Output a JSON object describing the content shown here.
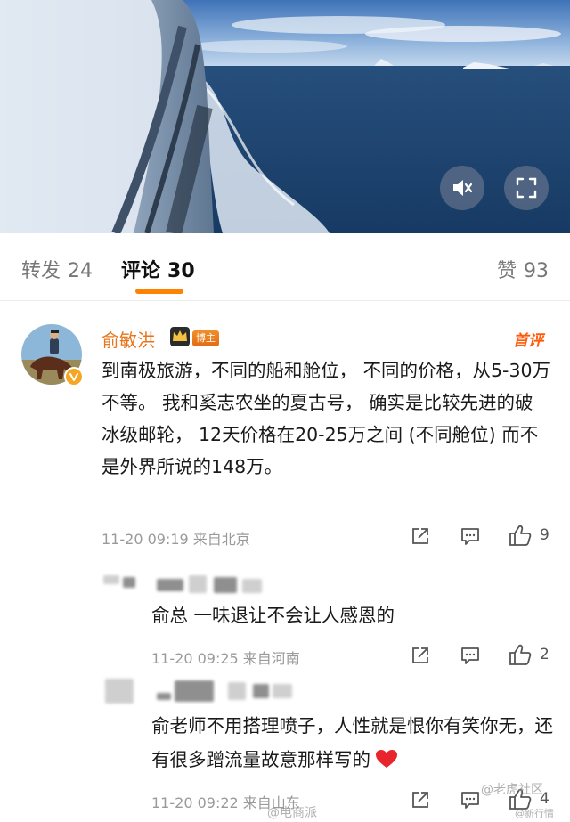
{
  "video": {
    "mute_icon": "mute-icon",
    "fullscreen_icon": "fullscreen-icon"
  },
  "tabs": {
    "repost": {
      "label": "转发",
      "count": "24"
    },
    "comment": {
      "label": "评论",
      "count": "30"
    },
    "like": {
      "label": "赞",
      "count": "93"
    },
    "active_color": "#ff8200"
  },
  "main_comment": {
    "author": "俞敏洪",
    "badge": "博主",
    "top_tag": "首评",
    "text": "到南极旅游，不同的船和舱位， 不同的价格，从5-30万不等。 我和奚志农坐的夏古号， 确实是比较先进的破冰级邮轮， 12天价格在20-25万之间 (不同舱位) 而不是外界所说的148万。",
    "time": "11-20 09:19",
    "location": "来自北京",
    "likes": "9",
    "author_color": "#e8751a"
  },
  "replies": [
    {
      "text": "俞总 一味退让不会让人感恩的",
      "time": "11-20 09:25",
      "location": "来自河南",
      "likes": "2"
    },
    {
      "text": "俞老师不用搭理喷子，人性就是恨你有笑你无，还有很多蹭流量故意那样写的",
      "time": "11-20 09:22",
      "location": "来自山东",
      "likes": "4"
    }
  ],
  "watermarks": {
    "bottom_right": "@老虎社区",
    "bottom_center": "@电商派",
    "corner": "@新行情"
  }
}
